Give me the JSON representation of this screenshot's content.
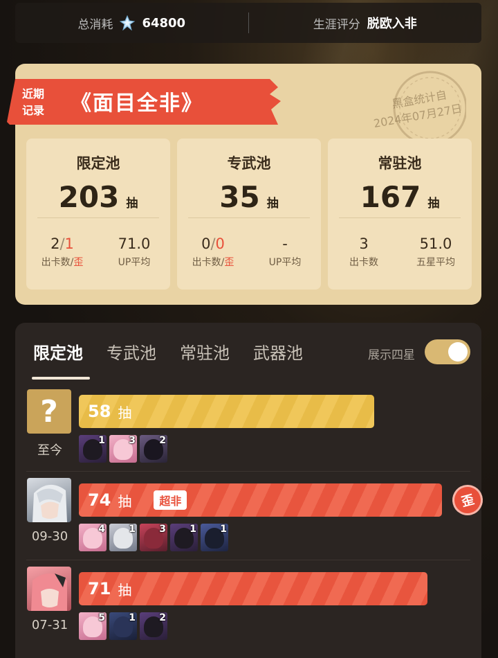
{
  "top": {
    "total_label": "总消耗",
    "total_value": "64800",
    "rating_label": "生涯评分",
    "rating_value": "脱欧入非"
  },
  "summary": {
    "ribbon_small_1": "近期",
    "ribbon_small_2": "记录",
    "ribbon_title": "《面目全非》",
    "stamp_line1": "黑盒统计自",
    "stamp_line2": "2024年07月27日",
    "pools": [
      {
        "name": "限定池",
        "count": "203",
        "unit": "抽",
        "stat1_value_a": "2",
        "stat1_value_sep": "/",
        "stat1_value_b": "1",
        "stat1_label_a": "出卡数/",
        "stat1_label_b": "歪",
        "stat2_value": "71.0",
        "stat2_label": "UP平均"
      },
      {
        "name": "专武池",
        "count": "35",
        "unit": "抽",
        "stat1_value_a": "0",
        "stat1_value_sep": "/",
        "stat1_value_b": "0",
        "stat1_label_a": "出卡数/",
        "stat1_label_b": "歪",
        "stat2_value": "-",
        "stat2_label": "UP平均"
      },
      {
        "name": "常驻池",
        "count": "167",
        "unit": "抽",
        "stat1_value_a": "3",
        "stat1_value_sep": "",
        "stat1_value_b": "",
        "stat1_label_a": "出卡数",
        "stat1_label_b": "",
        "stat2_value": "51.0",
        "stat2_label": "五星平均"
      }
    ]
  },
  "history": {
    "tabs": [
      "限定池",
      "专武池",
      "常驻池",
      "武器池"
    ],
    "active_tab": 0,
    "show_four_label": "展示四星",
    "show_four_on": true,
    "rows": [
      {
        "avatar": "?",
        "date": "至今",
        "count": "58",
        "unit": "抽",
        "badge": "",
        "wai": "",
        "bar_fraction": 0.58,
        "bar_color": "gold",
        "chars": [
          "1",
          "3",
          "2"
        ]
      },
      {
        "avatar": "character-silver-hair",
        "date": "09-30",
        "count": "74",
        "unit": "抽",
        "badge": "超非",
        "wai": "歪",
        "bar_fraction": 0.74,
        "bar_color": "red",
        "chars": [
          "4",
          "1",
          "3",
          "1",
          "1"
        ]
      },
      {
        "avatar": "character-pink-hair",
        "date": "07-31",
        "count": "71",
        "unit": "抽",
        "badge": "",
        "wai": "",
        "bar_fraction": 0.71,
        "bar_color": "red",
        "chars": [
          "5",
          "1",
          "2"
        ]
      }
    ]
  },
  "colors": {
    "accent_red": "#e8503a",
    "gold": "#f0c75a",
    "card_bg": "#e9d3a4"
  }
}
